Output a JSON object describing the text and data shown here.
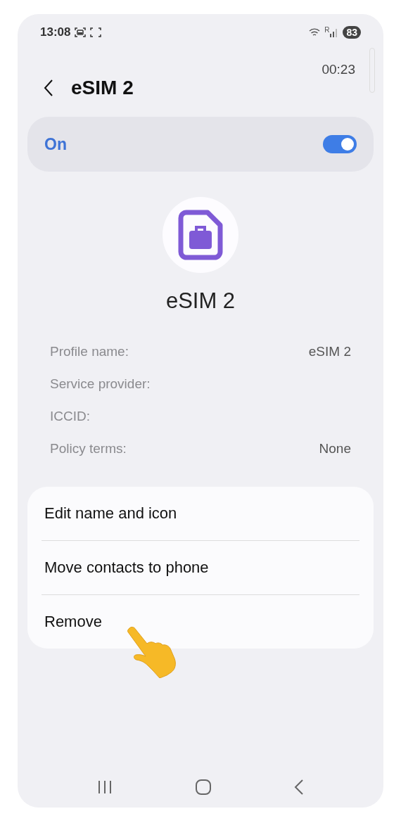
{
  "status_bar": {
    "time": "13:08",
    "battery": "83",
    "roaming": "R"
  },
  "header": {
    "title": "eSIM 2",
    "timer": "00:23"
  },
  "master_switch": {
    "label": "On",
    "on": true
  },
  "sim": {
    "name": "eSIM 2"
  },
  "details": [
    {
      "label": "Profile name:",
      "value": "eSIM 2"
    },
    {
      "label": "Service provider:"
    },
    {
      "label": "ICCID:"
    },
    {
      "label": "Policy terms:",
      "value": "None"
    }
  ],
  "actions": [
    "Edit name and icon",
    "Move contacts to phone",
    "Remove"
  ]
}
